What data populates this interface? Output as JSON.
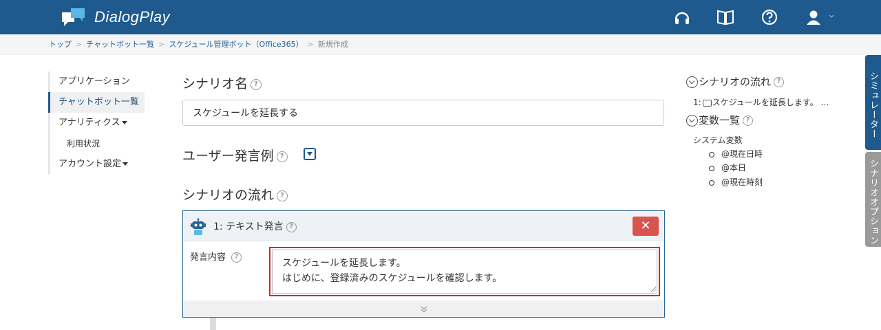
{
  "header": {
    "app_name": "DialogPlay",
    "icons": [
      "headset-icon",
      "book-icon",
      "help-icon",
      "user-icon"
    ],
    "brand_color": "#1f5a8f"
  },
  "breadcrumb": {
    "items": [
      "トップ",
      "チャットボット一覧",
      "スケジュール管理ボット（Office365）"
    ],
    "current": "新規作成"
  },
  "leftnav": {
    "items": [
      "アプリケーション",
      "チャットボット一覧",
      "アナリティクス",
      "利用状況",
      "アカウント設定"
    ]
  },
  "main": {
    "scenario_name_label": "シナリオ名",
    "scenario_name_value": "スケジュールを延長する",
    "user_utterance_label": "ユーザー発言例",
    "scenario_flow_label": "シナリオの流れ",
    "card": {
      "title": "1: テキスト発言",
      "delete_label": "✕",
      "field_label": "発言内容",
      "utterance_lines": [
        "スケジュールを延長します。",
        "はじめに、登録済みのスケジュールを確認します。"
      ],
      "footer_icon": "⌄"
    }
  },
  "right_panel": {
    "flow_title": "シナリオの流れ",
    "flow_item": "1:",
    "flow_item_text": "スケジュールを延長します。 …",
    "vars_title": "変数一覧",
    "system_vars_label": "システム変数",
    "vars": [
      "@現在日時",
      "@本日",
      "@現在時刻"
    ]
  },
  "side_tabs": {
    "simulator": "シミュレーター",
    "scenario_option": "シナリオオプション",
    "simulator_color": "#1f5a8f",
    "option_color": "#9a9a9a"
  }
}
